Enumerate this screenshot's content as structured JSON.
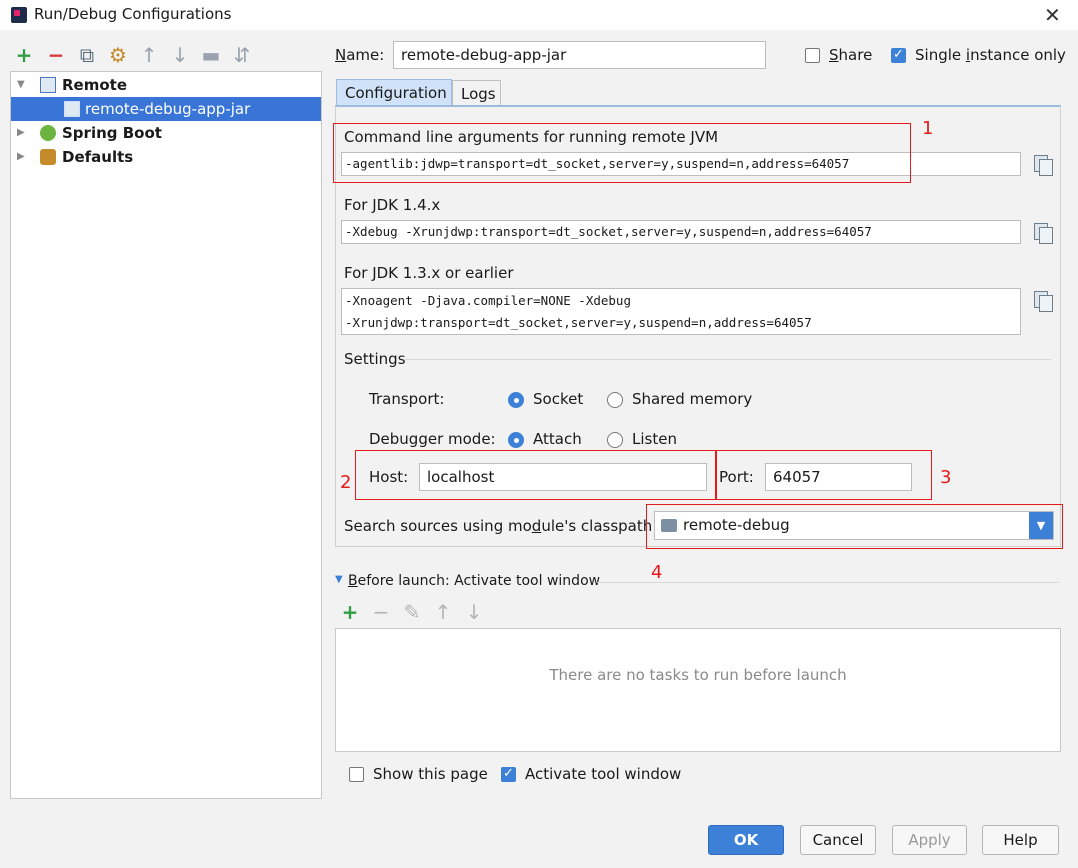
{
  "window": {
    "title": "Run/Debug Configurations",
    "close_glyph": "✕"
  },
  "toolbar": {
    "add": "+",
    "remove": "−",
    "copy": "⧉",
    "edit_defaults": "⚙",
    "up": "↑",
    "down": "↓",
    "folder": "▬",
    "sort": "⇵"
  },
  "tree": {
    "items": [
      {
        "label": "Remote",
        "arrow": "▼",
        "icon": "remote-icon"
      },
      {
        "label": "remote-debug-app-jar",
        "icon": "remote-config-icon"
      },
      {
        "label": "Spring Boot",
        "arrow": "▶",
        "icon": "spring-boot-icon"
      },
      {
        "label": "Defaults",
        "arrow": "▶",
        "icon": "defaults-icon"
      }
    ]
  },
  "name": {
    "label_first": "N",
    "label_rest": "ame:",
    "value": "remote-debug-app-jar"
  },
  "share": {
    "label_first": "S",
    "label_rest": "hare",
    "checked": false
  },
  "single_instance": {
    "label_pre": "Single ",
    "label_u": "i",
    "label_post": "nstance only",
    "checked": true
  },
  "tabs": [
    {
      "label": "Configuration"
    },
    {
      "label": "Logs"
    }
  ],
  "config": {
    "cmd_label": "Command line arguments for running remote JVM",
    "cmd_value": "-agentlib:jdwp=transport=dt_socket,server=y,suspend=n,address=64057",
    "jdk14_label": "For JDK 1.4.x",
    "jdk14_value": "-Xdebug -Xrunjdwp:transport=dt_socket,server=y,suspend=n,address=64057",
    "jdk13_label": "For JDK 1.3.x or earlier",
    "jdk13_line1": "-Xnoagent -Djava.compiler=NONE -Xdebug",
    "jdk13_line2": "-Xrunjdwp:transport=dt_socket,server=y,suspend=n,address=64057",
    "settings_label": "Settings",
    "transport_label": "Transport:",
    "transport_socket": "Socket",
    "transport_shared": "Shared memory",
    "debugger_mode_label": "Debugger mode:",
    "mode_attach": "Attach",
    "mode_listen": "Listen",
    "host_label": "Host:",
    "host_value": "localhost",
    "port_label": "Port:",
    "port_value": "64057",
    "classpath_label_pre": "Search sources using mo",
    "classpath_label_u": "d",
    "classpath_label_post": "ule's classpath:",
    "classpath_value": "remote-debug"
  },
  "annotations": {
    "n1": "1",
    "n2": "2",
    "n3": "3",
    "n4": "4",
    "color": "#e31b1b"
  },
  "before_launch": {
    "label_u": "B",
    "label_rest": "efore launch: Activate tool window",
    "add": "+",
    "remove": "−",
    "edit": "✎",
    "up": "↑",
    "down": "↓",
    "empty_text": "There are no tasks to run before launch"
  },
  "show_this_page": {
    "label": "Show this page",
    "checked": false
  },
  "activate_tool_window": {
    "label": "Activate tool window",
    "checked": true
  },
  "buttons": {
    "ok": "OK",
    "cancel": "Cancel",
    "apply": "Apply",
    "help": "Help"
  },
  "colors": {
    "accent": "#3c80d8",
    "selection": "#3875d7",
    "annotation": "#e31b1b"
  }
}
